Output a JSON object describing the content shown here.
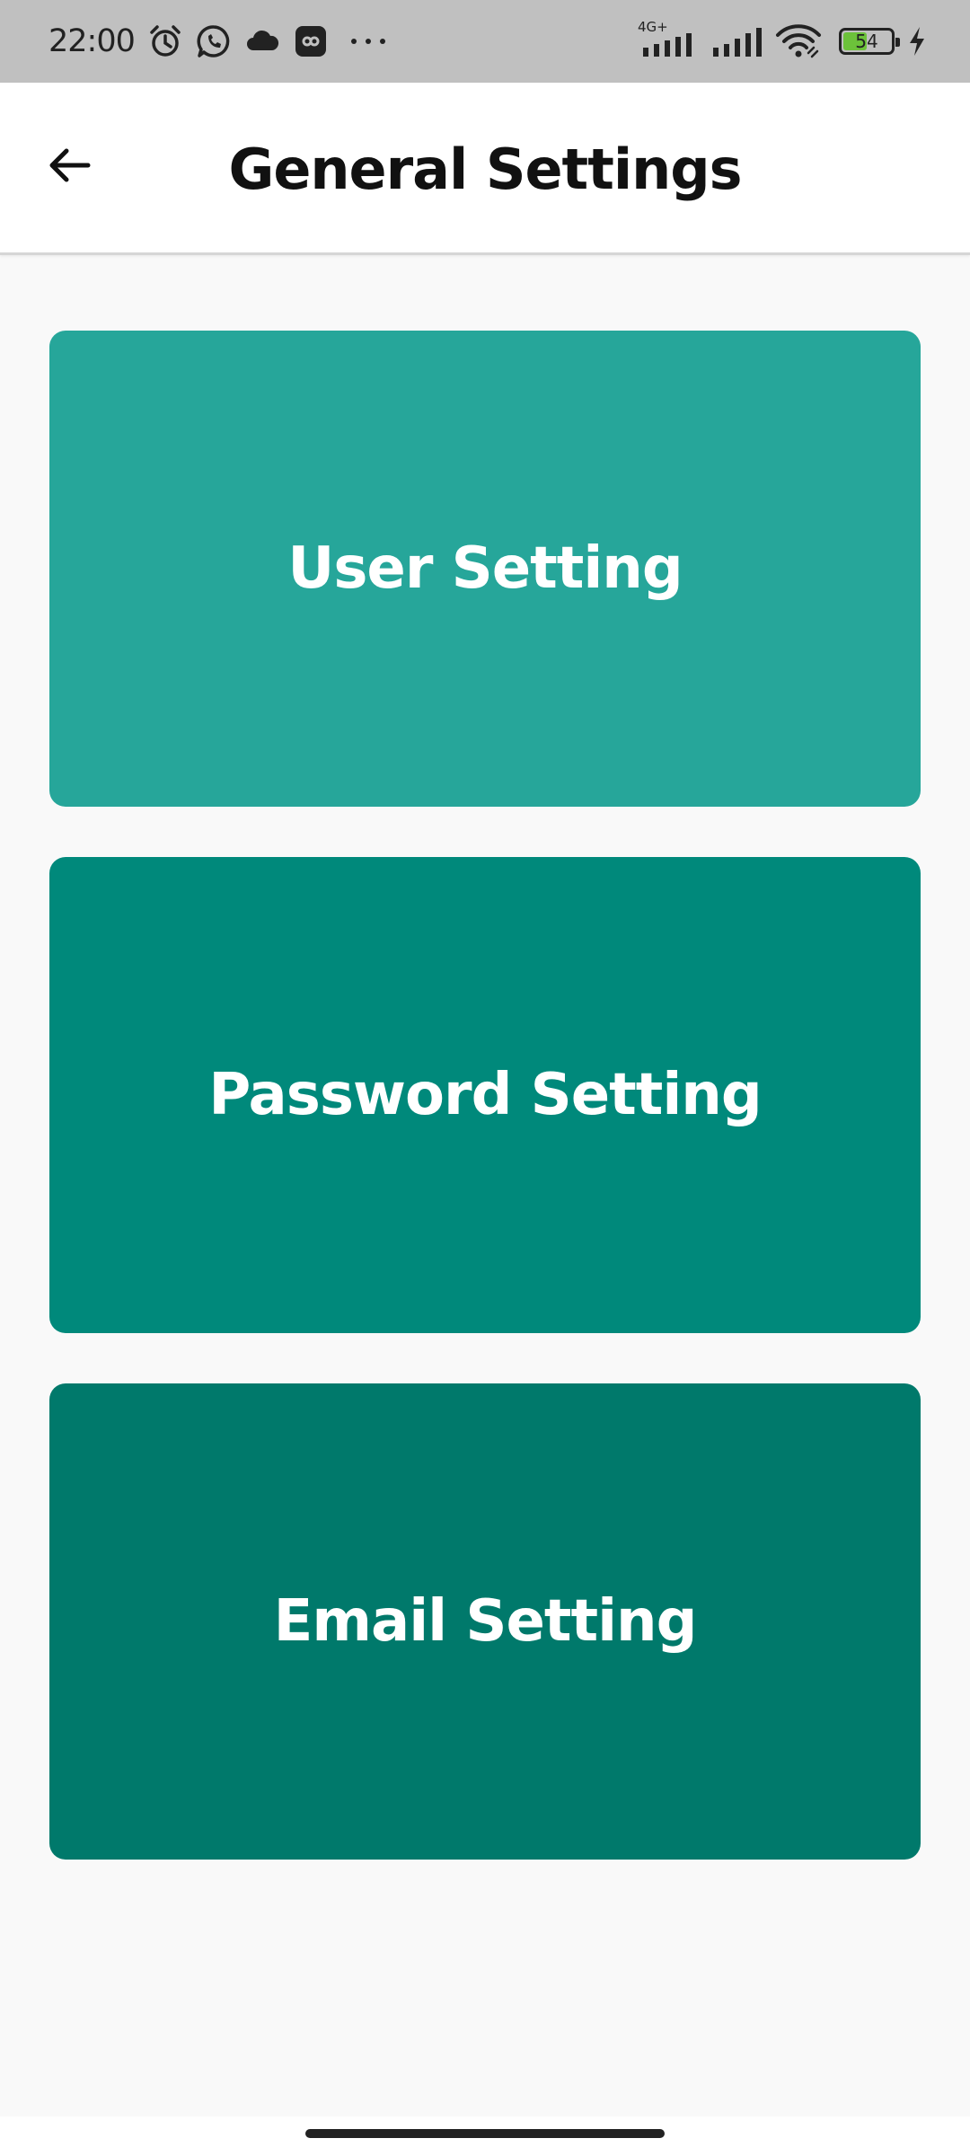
{
  "status_bar": {
    "time": "22:00",
    "network_label": "4G+",
    "battery_level": "54",
    "battery_fraction": 0.54,
    "icons": [
      "alarm-icon",
      "whatsapp-icon",
      "cloud-icon",
      "link-app-icon",
      "more-dots-icon",
      "signal-icon",
      "signal-icon-2",
      "wifi-icon",
      "battery-icon",
      "charging-icon"
    ]
  },
  "app_bar": {
    "title": "General Settings",
    "back_icon": "back-arrow-icon"
  },
  "cards": [
    {
      "label": "User Setting",
      "color": "#26a69a"
    },
    {
      "label": "Password Setting",
      "color": "#00897b"
    },
    {
      "label": "Email Setting",
      "color": "#00796b"
    }
  ],
  "colors": {
    "background": "#f9f9f9",
    "status_bar": "#c0c0c0",
    "app_bar": "#ffffff"
  }
}
